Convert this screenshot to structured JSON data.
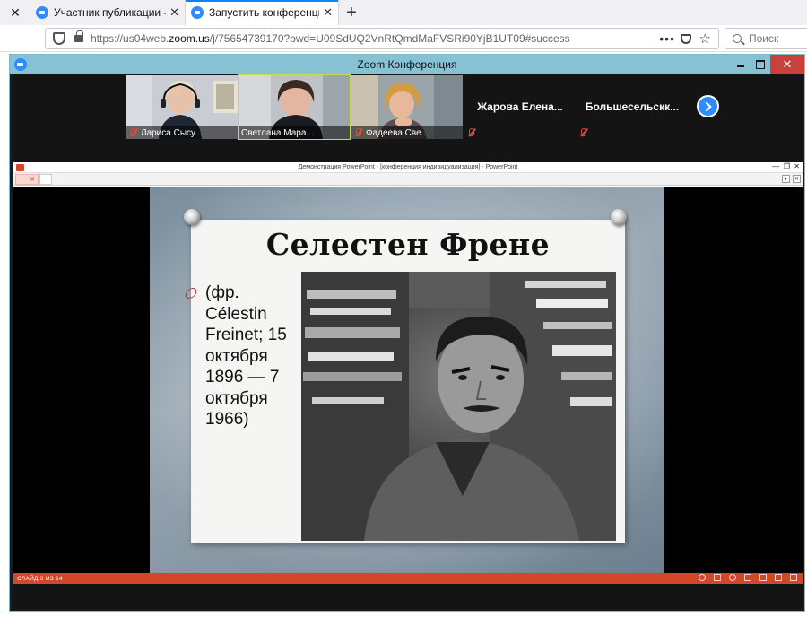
{
  "browser": {
    "tabs": [
      {
        "title": "Участник публикации - Zoom",
        "active": false
      },
      {
        "title": "Запустить конференцию - Zoom",
        "active": true
      }
    ],
    "url_prefix": "https://us04web.",
    "url_domain": "zoom.us",
    "url_rest": "/j/75654739170?pwd=U09SdUQ2VnRtQmdMaFVSRi90YjB1UT09#success",
    "search_placeholder": "Поиск"
  },
  "zoom": {
    "window_title": "Zoom Конференция",
    "participants": [
      {
        "name": "Лариса Сысу...",
        "video": true,
        "muted": true
      },
      {
        "name": "Светлана Мара...",
        "video": true,
        "muted": true,
        "active_speaker": true
      },
      {
        "name": "Фадеева Све...",
        "video": true,
        "muted": true
      },
      {
        "name": "Жарова  Елена...",
        "video": false,
        "muted": true
      },
      {
        "name": "Большесельскк...",
        "video": false,
        "muted": true
      }
    ]
  },
  "powerpoint": {
    "window_title": "Демонстрация PowerPoint - [конференция индивидуализация] - PowerPoint",
    "slide": {
      "title": "Селестен  Френе",
      "bullet_text": "(фр. Célestin Freinet; 15 октября 1896 — 7 октября 1966)"
    },
    "status_text": "СЛАЙД 3 ИЗ 14"
  },
  "colors": {
    "zoom_blue": "#2d8cff",
    "zoom_titlebar": "#86c2d4",
    "ppt_accent": "#d24726",
    "close_red": "#c8413a"
  }
}
